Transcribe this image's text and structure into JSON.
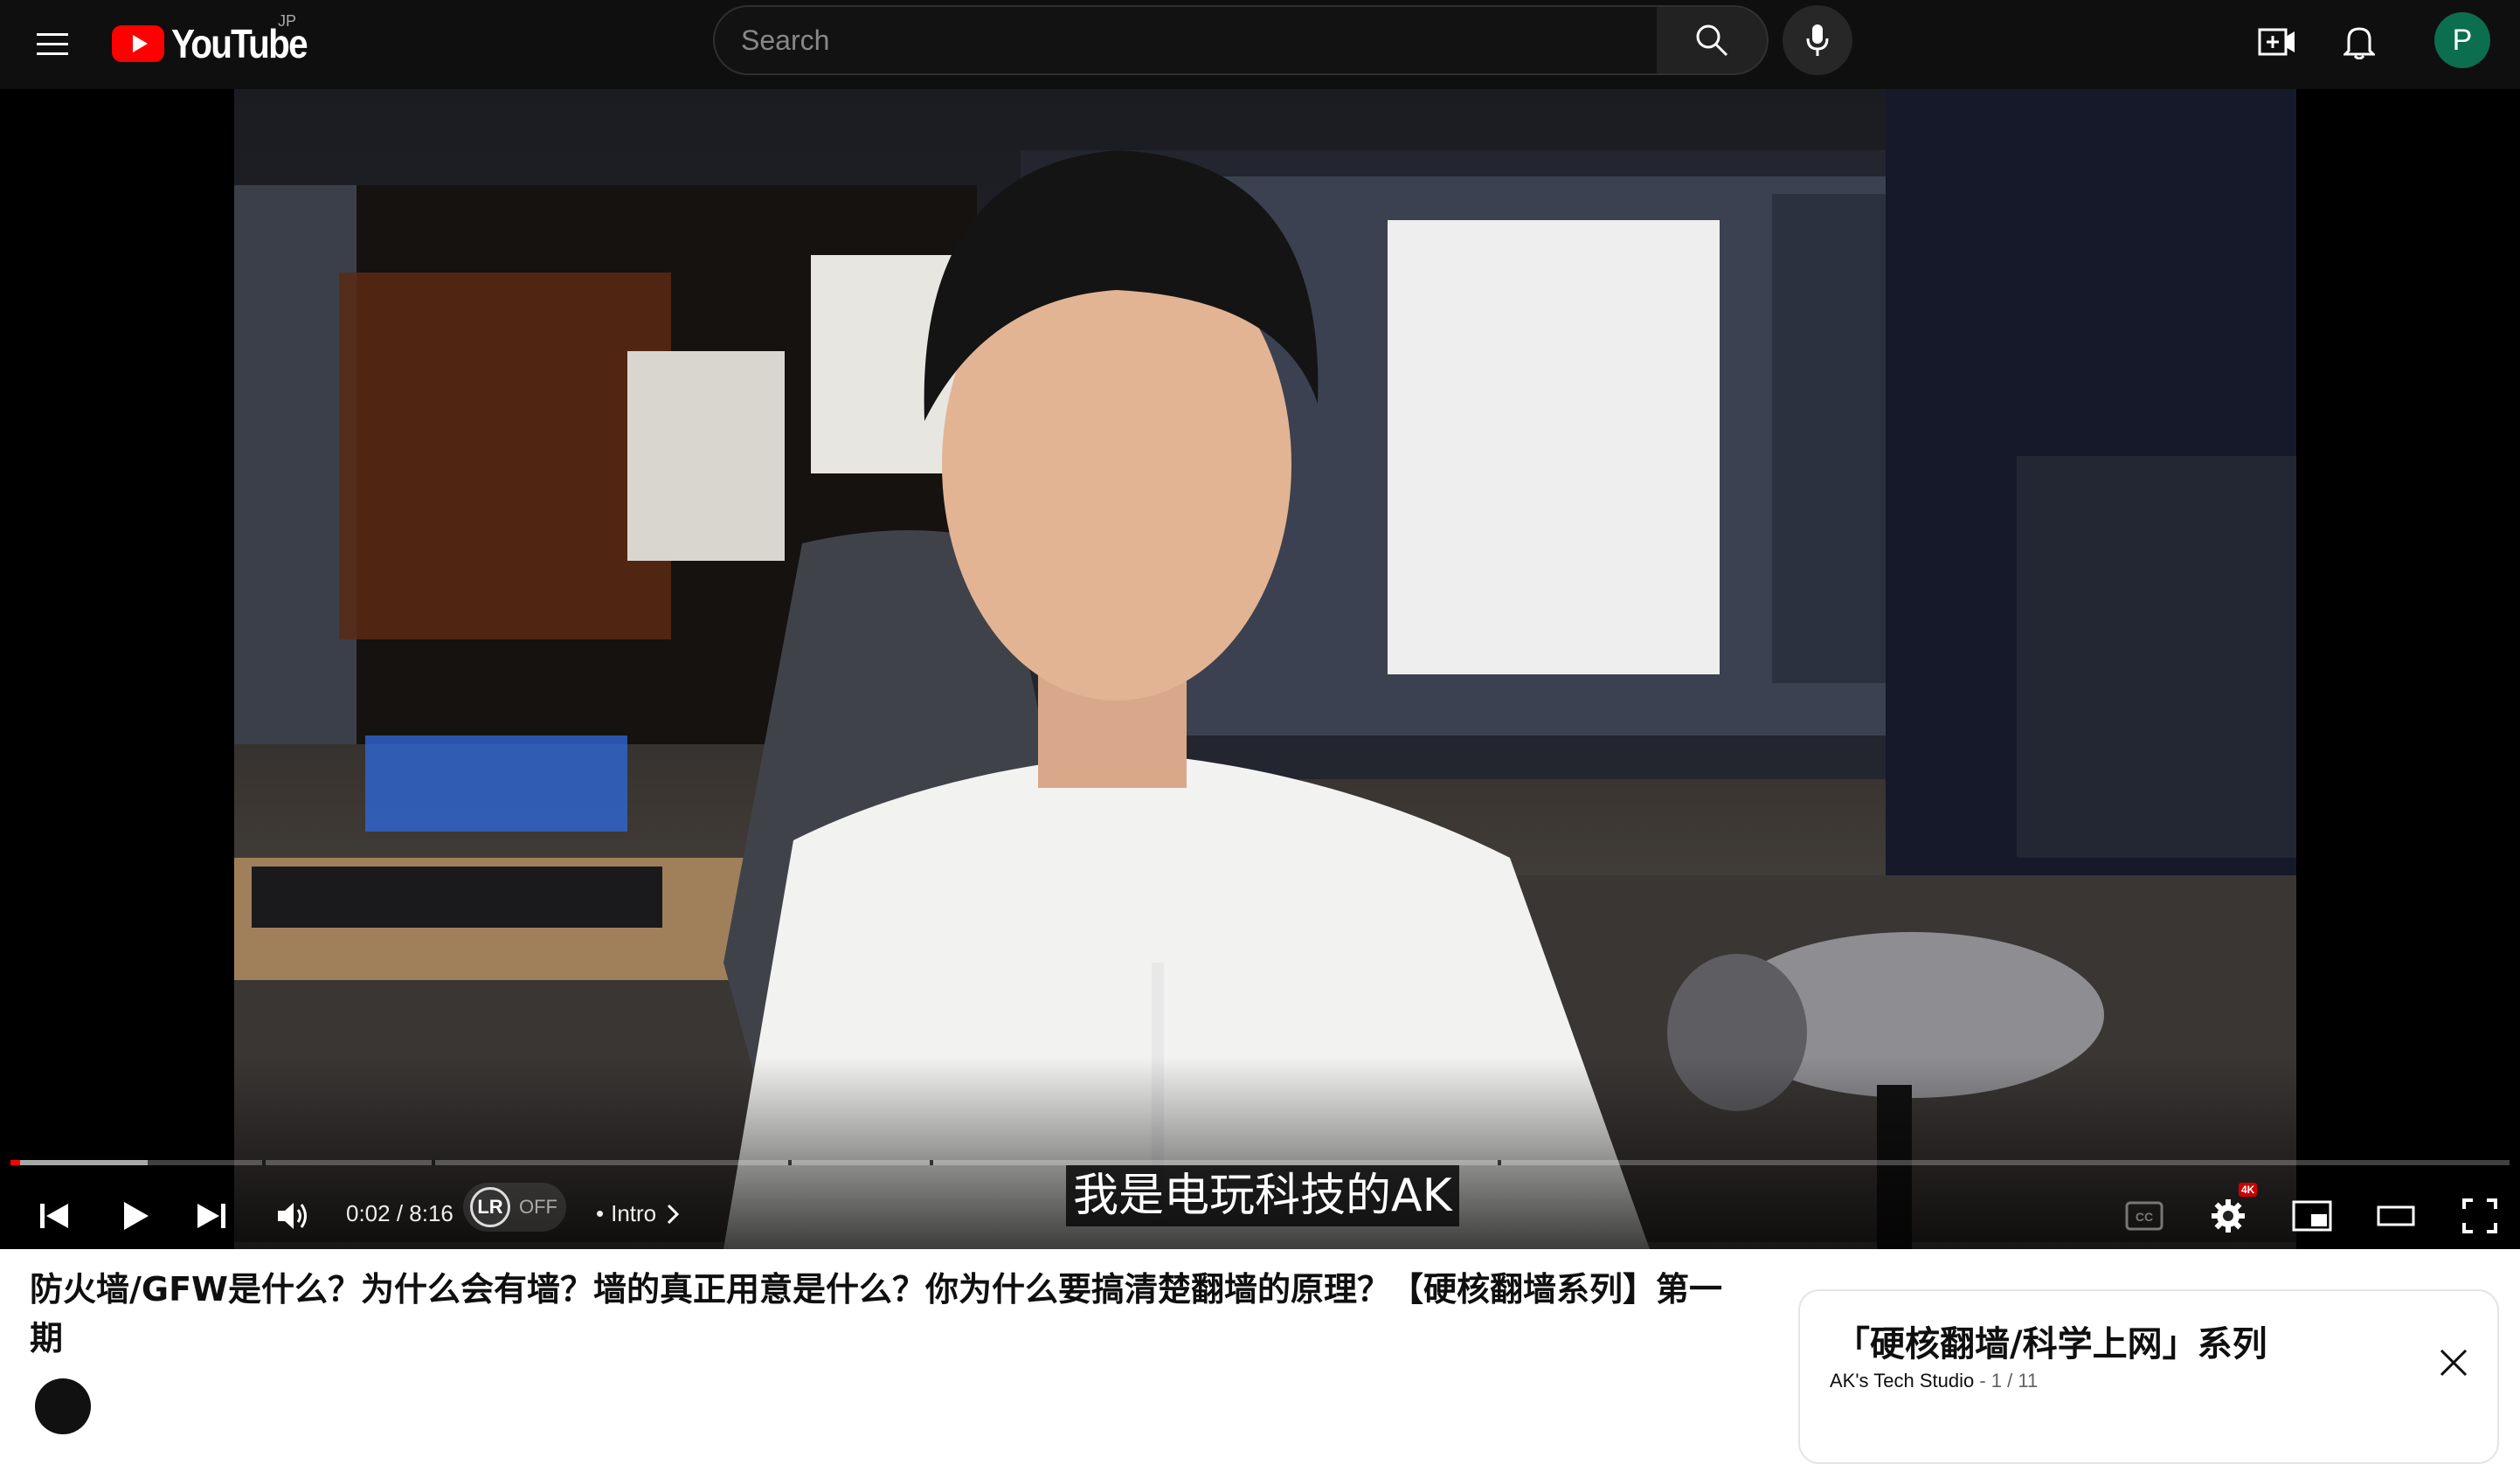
{
  "masthead": {
    "logo_text": "YouTube",
    "region_code": "JP",
    "search_placeholder": "Search",
    "avatar_letter": "P",
    "icons": [
      "menu-icon",
      "youtube-logo-icon",
      "search-icon",
      "mic-icon",
      "create-icon",
      "bell-icon"
    ]
  },
  "player": {
    "current_time": "0:02",
    "duration": "8:16",
    "time_display": "0:02 / 8:16",
    "progress_fraction": 0.004,
    "buffered_fraction": 0.055,
    "autodub_badge": "LR",
    "autodub_state": "OFF",
    "chapter_separator": "•",
    "chapter_title": "Intro",
    "subtitle_text": "我是电玩科技的AK",
    "settings_badge": "4K",
    "icons": [
      "previous-icon",
      "play-icon",
      "next-icon",
      "volume-icon",
      "chevron-right-icon",
      "captions-icon",
      "settings-icon",
      "miniplayer-icon",
      "theater-icon",
      "fullscreen-icon"
    ]
  },
  "video": {
    "title": "防火墙/GFW是什么？为什么会有墙？墙的真正用意是什么？你为什么要搞清楚翻墙的原理？【硬核翻墙系列】第一期"
  },
  "playlist": {
    "title": "「硬核翻墙/科学上网」系列",
    "channel": "AK's Tech Studio",
    "meta_separator": " - ",
    "position": "1 / 11"
  },
  "colors": {
    "masthead_bg": "#0f0f0f",
    "brand_red": "#ff0000",
    "avatar_bg": "#0b6e4f",
    "page_bg": "#ffffff"
  }
}
